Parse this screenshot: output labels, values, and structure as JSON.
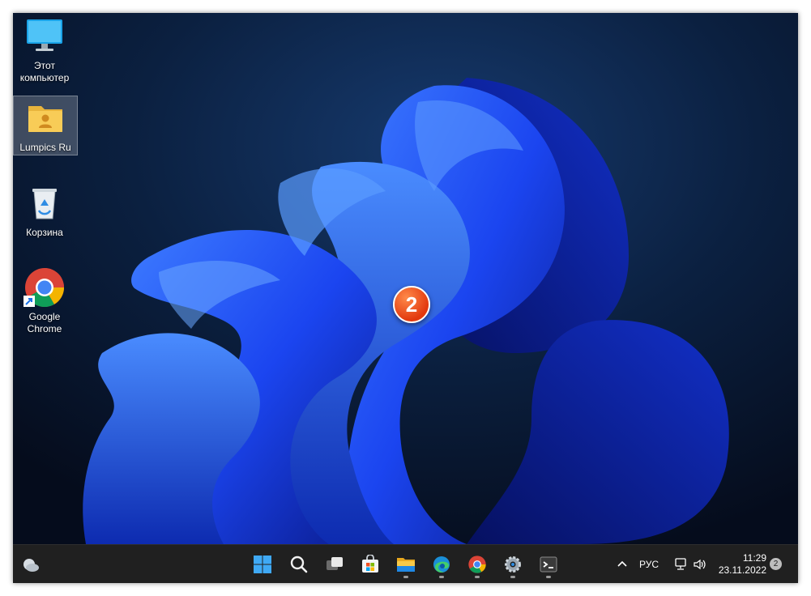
{
  "desktop": {
    "icons": [
      {
        "label_line1": "Этот",
        "label_line2": "компьютер",
        "icon": "monitor-icon"
      },
      {
        "label_line1": "Lumpics Ru",
        "label_line2": "",
        "icon": "user-folder-icon"
      },
      {
        "label_line1": "Корзина",
        "label_line2": "",
        "icon": "recycle-bin-icon"
      },
      {
        "label_line1": "Google",
        "label_line2": "Chrome",
        "icon": "chrome-icon"
      }
    ],
    "step_badge": "2"
  },
  "taskbar": {
    "pinned": [
      "weather-icon",
      "start-icon",
      "search-icon",
      "task-view-icon",
      "store-icon",
      "file-explorer-icon",
      "edge-icon",
      "chrome-icon",
      "settings-icon",
      "terminal-icon"
    ],
    "tray": {
      "language": "РУС",
      "time": "11:29",
      "date": "23.11.2022",
      "notifications": "2"
    }
  },
  "colors": {
    "taskbar_bg": "#202020",
    "wallpaper_base": "#0a1a33",
    "accent": "#1e4fff",
    "badge": "#e2390d"
  }
}
